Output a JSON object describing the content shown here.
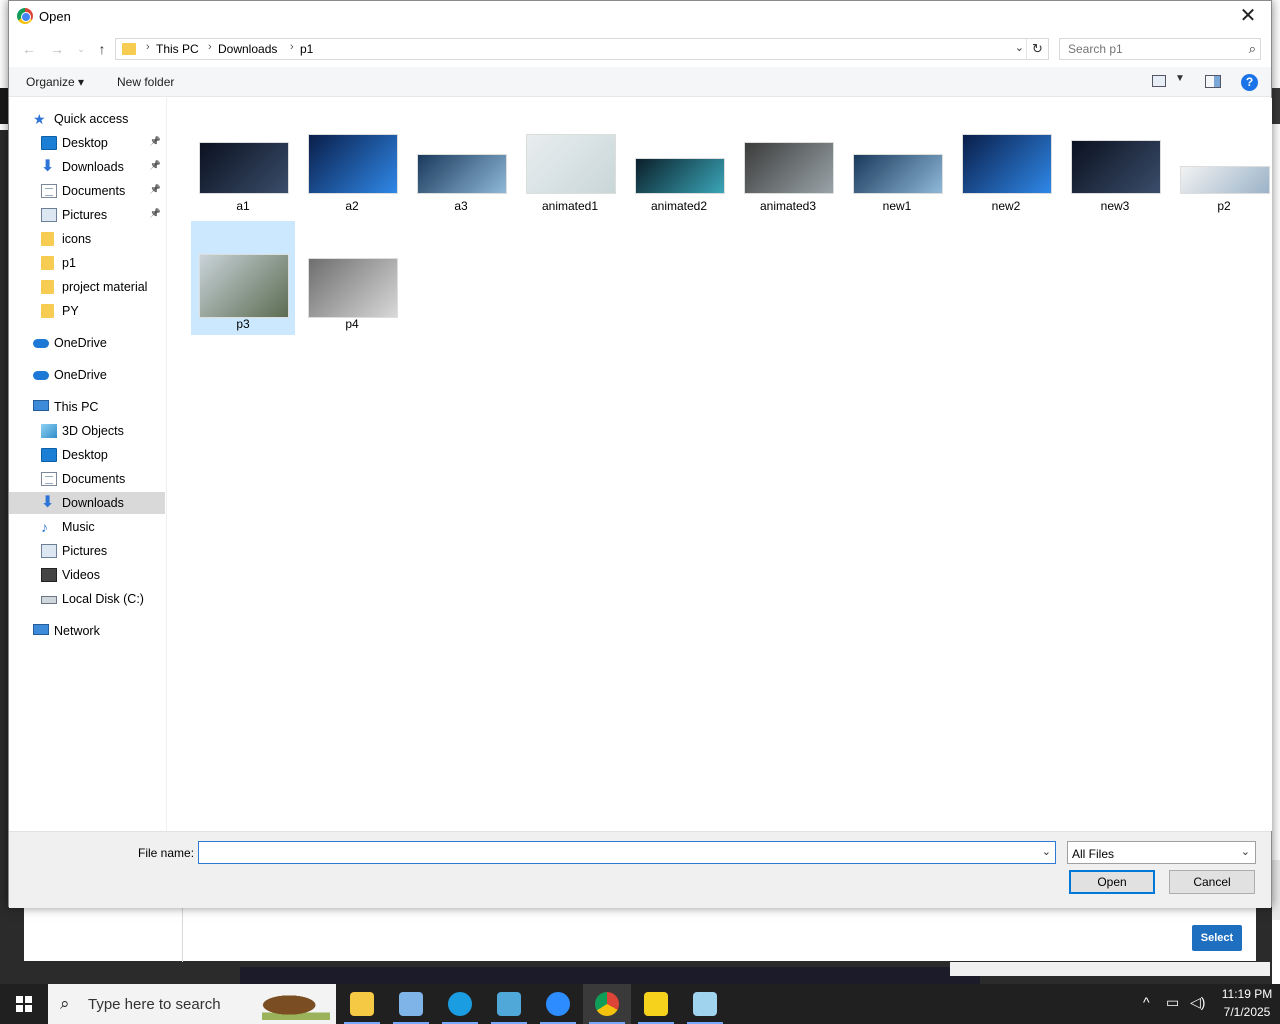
{
  "dialog": {
    "title": "Open",
    "close_glyph": "✕"
  },
  "address": {
    "crumbs": [
      "This PC",
      "Downloads",
      "p1"
    ]
  },
  "search": {
    "placeholder": "Search p1"
  },
  "commands": {
    "organize": "Organize ▾",
    "new_folder": "New folder"
  },
  "sidebar": {
    "items": [
      {
        "label": "Quick access",
        "icon": "star-icon",
        "pinned": false
      },
      {
        "label": "Desktop",
        "icon": "desktop-icon",
        "pinned": true
      },
      {
        "label": "Downloads",
        "icon": "download-icon",
        "pinned": true
      },
      {
        "label": "Documents",
        "icon": "document-icon",
        "pinned": true
      },
      {
        "label": "Pictures",
        "icon": "pictures-icon",
        "pinned": true
      },
      {
        "label": "icons",
        "icon": "folder-icon",
        "pinned": false
      },
      {
        "label": "p1",
        "icon": "folder-icon",
        "pinned": false
      },
      {
        "label": "project material",
        "icon": "folder-icon",
        "pinned": false
      },
      {
        "label": "PY",
        "icon": "folder-icon",
        "pinned": false
      },
      {
        "label": "OneDrive",
        "icon": "cloud-icon",
        "pinned": false
      },
      {
        "label": "OneDrive",
        "icon": "cloud-icon",
        "pinned": false
      },
      {
        "label": "This PC",
        "icon": "computer-icon",
        "pinned": false
      },
      {
        "label": "3D Objects",
        "icon": "cube-icon",
        "pinned": false
      },
      {
        "label": "Desktop",
        "icon": "desktop-icon",
        "pinned": false
      },
      {
        "label": "Documents",
        "icon": "document-icon",
        "pinned": false
      },
      {
        "label": "Downloads",
        "icon": "download-icon",
        "pinned": false,
        "selected": true
      },
      {
        "label": "Music",
        "icon": "music-icon",
        "pinned": false
      },
      {
        "label": "Pictures",
        "icon": "pictures-icon",
        "pinned": false
      },
      {
        "label": "Videos",
        "icon": "video-icon",
        "pinned": false
      },
      {
        "label": "Local Disk (C:)",
        "icon": "disk-icon",
        "pinned": false
      },
      {
        "label": "Network",
        "icon": "network-icon",
        "pinned": false
      }
    ]
  },
  "files": [
    {
      "name": "a1",
      "colors": [
        "#0b1120",
        "#3a4d6a"
      ]
    },
    {
      "name": "a2",
      "colors": [
        "#0a1e4a",
        "#2f88e8"
      ]
    },
    {
      "name": "a3",
      "colors": [
        "#1a3a5c",
        "#8fb8d8"
      ]
    },
    {
      "name": "animated1",
      "colors": [
        "#e8eef0",
        "#c9d6d8"
      ]
    },
    {
      "name": "animated2",
      "colors": [
        "#0b1f2a",
        "#3aa6b8"
      ]
    },
    {
      "name": "animated3",
      "colors": [
        "#3b3b3b",
        "#9aa4a8"
      ]
    },
    {
      "name": "new1",
      "colors": [
        "#1a3a5c",
        "#8fb8d8"
      ]
    },
    {
      "name": "new2",
      "colors": [
        "#0a1e4a",
        "#2f88e8"
      ]
    },
    {
      "name": "new3",
      "colors": [
        "#0b1120",
        "#3a4d6a"
      ]
    },
    {
      "name": "p2",
      "colors": [
        "#f2f2f2",
        "#9bb3c8"
      ]
    },
    {
      "name": "p3",
      "colors": [
        "#c9d3d8",
        "#5b6c52"
      ],
      "selected": true
    },
    {
      "name": "p4",
      "colors": [
        "#6e6e6e",
        "#d8d8d8"
      ]
    }
  ],
  "bottom": {
    "file_name_label": "File name:",
    "file_name_value": "",
    "filter": "All Files",
    "open": "Open",
    "cancel": "Cancel"
  },
  "background_app": {
    "select_label": "Select"
  },
  "taskbar": {
    "search_placeholder": "Type here to search",
    "apps": [
      {
        "name": "file-explorer-icon",
        "color": "#f6c944"
      },
      {
        "name": "paint-icon",
        "color": "#7fb4e8"
      },
      {
        "name": "edge-icon",
        "color": "#1b9de2"
      },
      {
        "name": "app-icon",
        "color": "#4fa8d8"
      },
      {
        "name": "zoom-icon",
        "color": "#2d8cff"
      },
      {
        "name": "chrome-icon",
        "color": "#db4437"
      },
      {
        "name": "sticky-notes-icon",
        "color": "#f7d21c"
      },
      {
        "name": "notepad-icon",
        "color": "#9fd3ee"
      }
    ],
    "time": "11:19 PM",
    "date": "7/1/2025"
  }
}
